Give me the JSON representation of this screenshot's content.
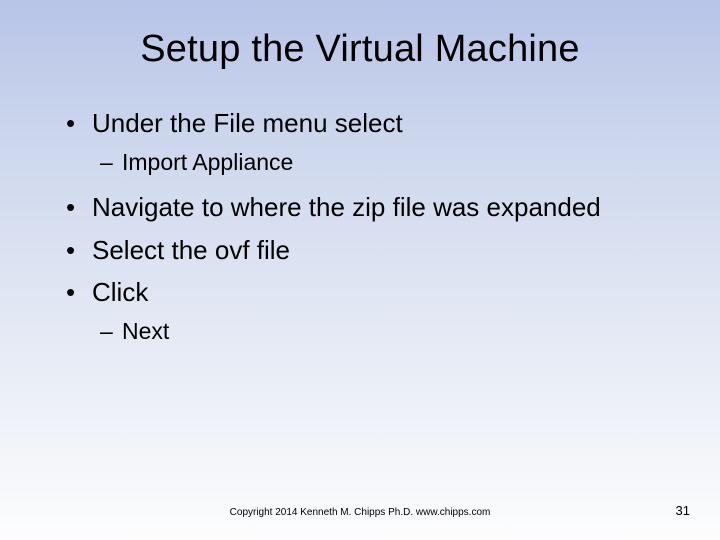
{
  "title": "Setup the Virtual Machine",
  "bullets": [
    {
      "text": "Under the File menu select",
      "sub": [
        "Import Appliance"
      ]
    },
    {
      "text": "Navigate to where the zip file was expanded"
    },
    {
      "text": "Select the ovf file"
    },
    {
      "text": "Click",
      "sub": [
        "Next"
      ]
    }
  ],
  "footer": {
    "copyright": "Copyright 2014 Kenneth M. Chipps Ph.D. www.chipps.com",
    "page": "31"
  }
}
